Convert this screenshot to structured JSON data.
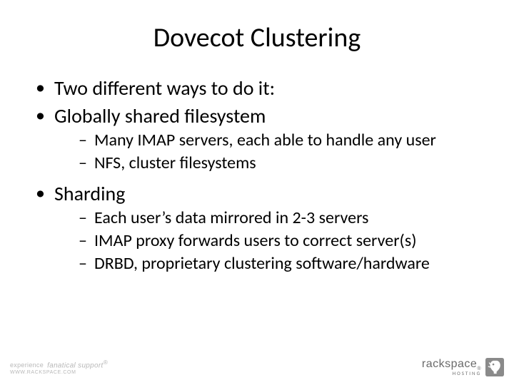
{
  "title": "Dovecot Clustering",
  "bullets": {
    "b1": "Two different ways to do it:",
    "b2": "Globally shared filesystem",
    "b2_sub": {
      "s1": "Many IMAP servers, each able to handle any user",
      "s2": "NFS, cluster filesystems"
    },
    "b3": "Sharding",
    "b3_sub": {
      "s1": "Each user’s data mirrored in 2-3 servers",
      "s2": "IMAP proxy forwards users to correct server(s)",
      "s3": "DRBD, proprietary clustering software/hardware"
    }
  },
  "footer": {
    "left_prefix": "experience",
    "left_main": "fanatical support",
    "left_domain": "WWW.RACKSPACE.COM",
    "brand": "rackspace",
    "brand_sub": "HOSTING"
  }
}
